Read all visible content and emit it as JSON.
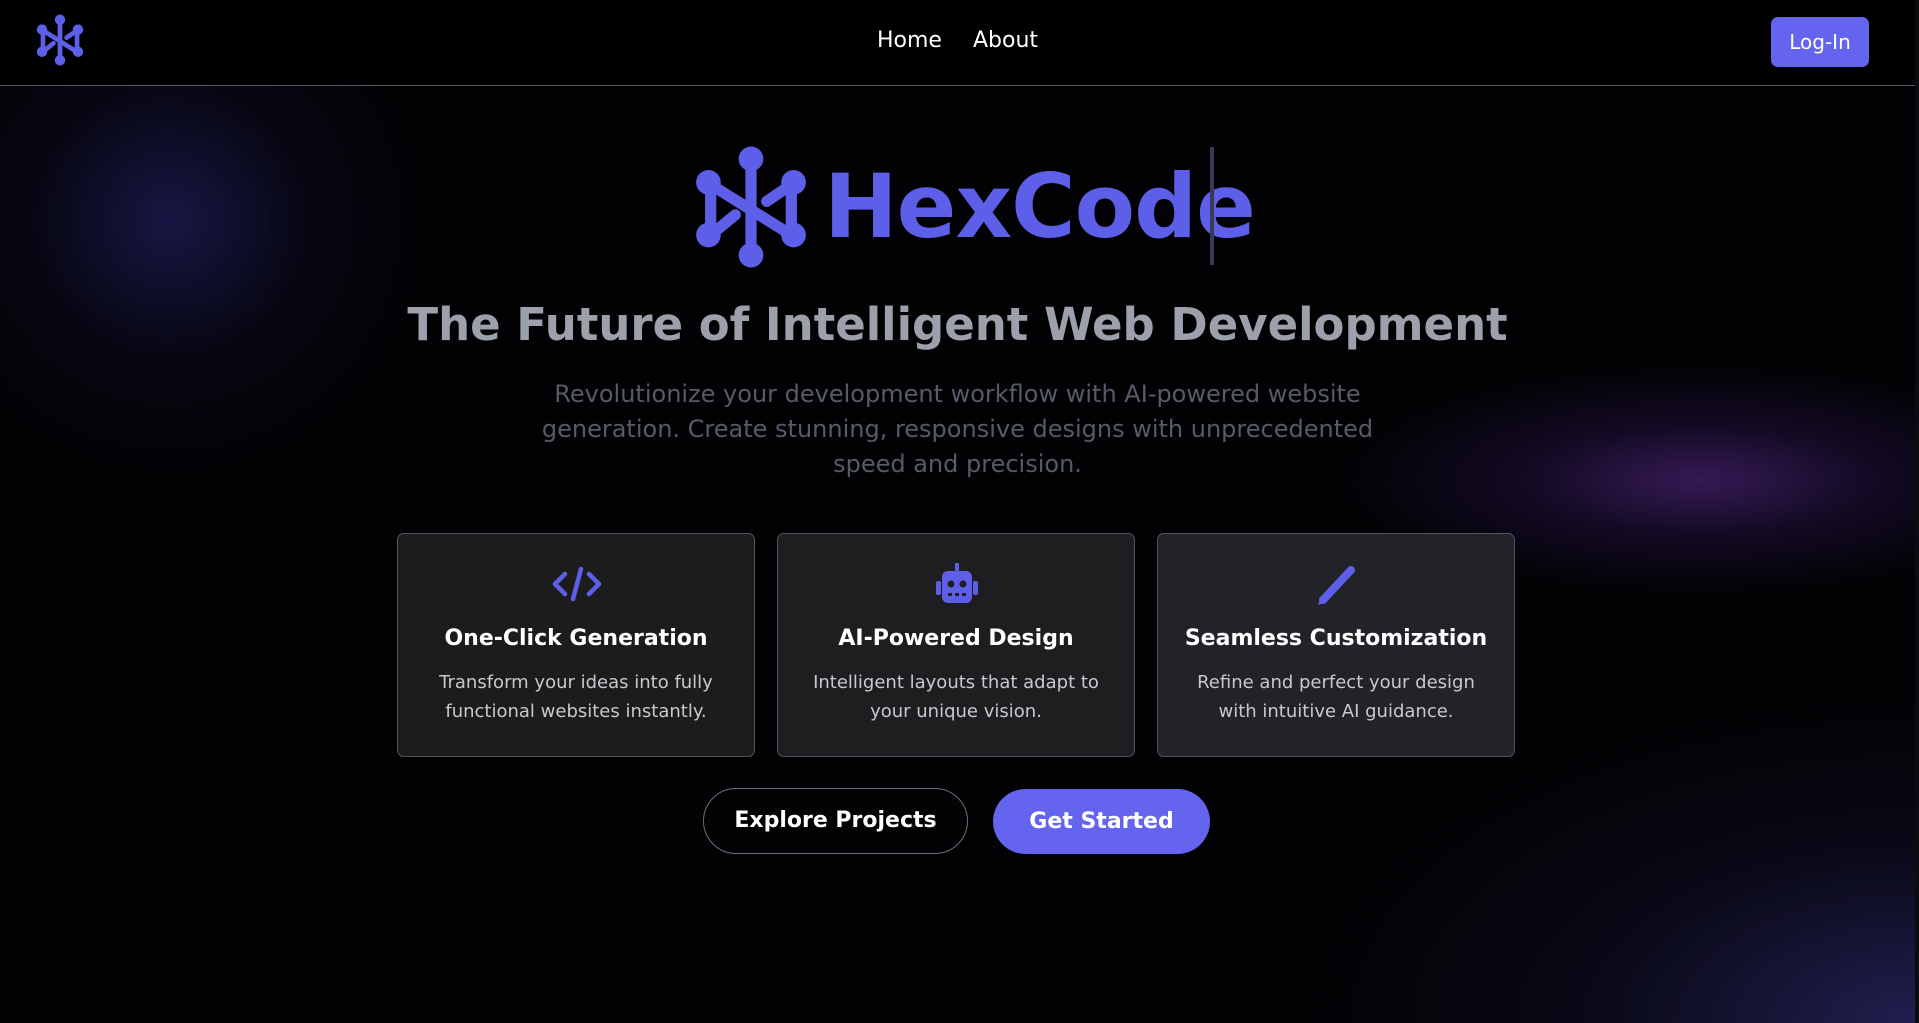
{
  "nav": {
    "links": [
      "Home",
      "About"
    ],
    "login_label": "Log-In"
  },
  "hero": {
    "brand": "HexCode",
    "headline": "The Future of Intelligent Web Development",
    "subtext": "Revolutionize your development workflow with AI-powered website generation. Create stunning, responsive designs with unprecedented speed and precision."
  },
  "features": [
    {
      "icon": "code-icon",
      "title": "One-Click Generation",
      "desc": "Transform your ideas into fully functional websites instantly."
    },
    {
      "icon": "robot-icon",
      "title": "AI-Powered Design",
      "desc": "Intelligent layouts that adapt to your unique vision."
    },
    {
      "icon": "pen-icon",
      "title": "Seamless Customization",
      "desc": "Refine and perfect your design with intuitive AI guidance."
    }
  ],
  "cta": {
    "explore_label": "Explore Projects",
    "start_label": "Get Started"
  },
  "colors": {
    "accent": "#6464ef",
    "brand_text": "#5e5fe8",
    "background": "#000000"
  }
}
